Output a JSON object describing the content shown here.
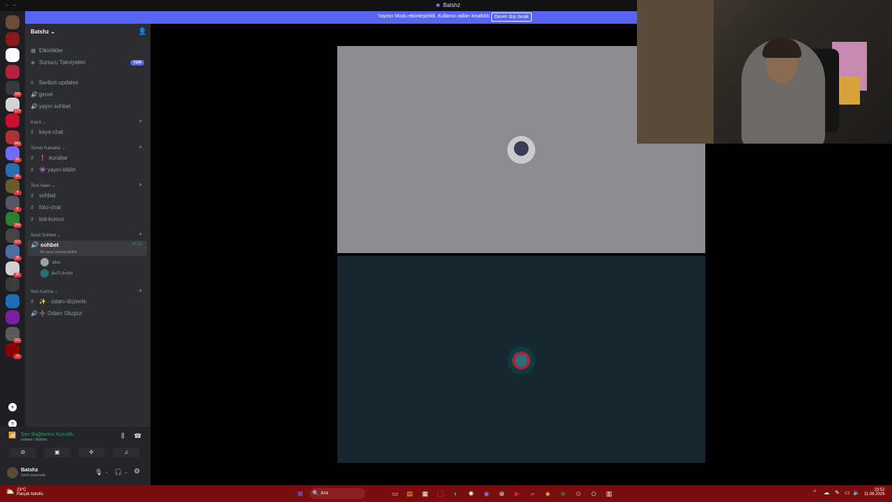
{
  "titlebar": {
    "title": "Batshz"
  },
  "banner": {
    "message": "Yayıncı Modu etkinleştirildi. Kullanıcı adları kısaltıldı.",
    "button": "Devre dışı bırak"
  },
  "rail": {
    "badges": [
      "",
      "",
      "",
      "",
      "162",
      "124",
      "",
      "682",
      "60",
      "86",
      "4",
      "6",
      "264",
      "112",
      "35",
      "98",
      "",
      "",
      "",
      "311",
      "72"
    ]
  },
  "sidebar": {
    "guild_name": "Batshz",
    "events": "Etkinlikler",
    "boosts": "Sunucu Takviyeleri",
    "new_badge": "YENİ",
    "channels_top": [
      {
        "icon": "hash",
        "label": "flavibot-updates"
      },
      {
        "icon": "speaker",
        "label": "genel"
      },
      {
        "icon": "speaker",
        "label": "yayın sohbet"
      }
    ],
    "categories": [
      {
        "name": "Kayıt",
        "channels": [
          {
            "icon": "hash",
            "label": "kayıt-chat"
          }
        ]
      },
      {
        "name": "Temel Kanallar",
        "channels": [
          {
            "icon": "hash",
            "label": "❗ ·kurallar"
          },
          {
            "icon": "hash",
            "label": "👾 yayın-bildiri"
          }
        ]
      },
      {
        "name": "Text Alanı",
        "channels": [
          {
            "icon": "hash",
            "label": "sohbet"
          },
          {
            "icon": "hash",
            "label": "foto-chat"
          },
          {
            "icon": "hash",
            "label": "bot-komut"
          }
        ]
      },
      {
        "name": "Sesli Sohbet",
        "channels": []
      },
      {
        "name": "Ses Kurma",
        "channels": [
          {
            "icon": "hash",
            "label": "✨ · odanı-düzenle"
          },
          {
            "icon": "speaker",
            "label": "➕ Odanı Oluştur"
          }
        ]
      }
    ],
    "active_voice": {
      "label": "sohbet",
      "timer": "27:23",
      "status_hint": "Bir kanal durumu belirle",
      "members": [
        "alsu",
        "BATUHAN"
      ]
    }
  },
  "voice_panel": {
    "status": "Ses Bağlantısı Kuruldu",
    "location": "sohbet / Batshz",
    "username": "Batshz",
    "user_status": "Sesli aramada"
  },
  "taskbar": {
    "temperature": "23°C",
    "weather": "Parçalı bulutlu",
    "search": "Ara",
    "time": "23:52",
    "date": "11.08.2026"
  }
}
